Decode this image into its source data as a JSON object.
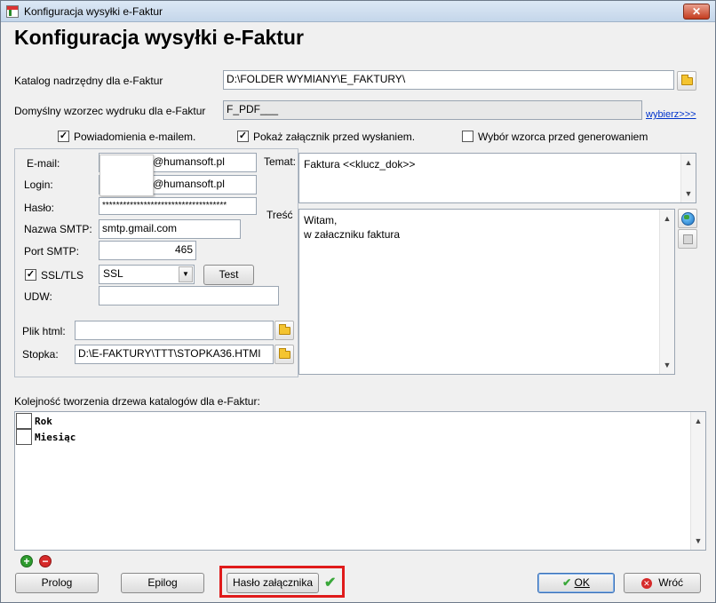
{
  "window": {
    "title": "Konfiguracja wysyłki e-Faktur",
    "close_glyph": "✕"
  },
  "heading": "Konfiguracja wysyłki e-Faktur",
  "catalog": {
    "label": "Katalog nadrzędny dla e-Faktur",
    "value": "D:\\FOLDER WYMIANY\\E_FAKTURY\\"
  },
  "template": {
    "label": "Domyślny wzorzec wydruku dla e-Faktur",
    "value": "F_PDF___",
    "link": "wybierz>>>"
  },
  "options": [
    {
      "label": "Powiadomienia e-mailem.",
      "checked": true
    },
    {
      "label": "Pokaż załącznik przed wysłaniem.",
      "checked": true
    },
    {
      "label": "Wybór wzorca przed generowaniem",
      "checked": false
    }
  ],
  "mail": {
    "email_label": "E-mail:",
    "email_value": "@humansoft.pl",
    "login_label": "Login:",
    "login_value": "@humansoft.pl",
    "password_label": "Hasło:",
    "password_value": "************************************",
    "smtp_label": "Nazwa SMTP:",
    "smtp_value": "smtp.gmail.com",
    "port_label": "Port SMTP:",
    "port_value": "465",
    "ssl_label": "SSL/TLS",
    "ssl_checked": true,
    "ssl_select": "SSL",
    "test_button": "Test",
    "udw_label": "UDW:",
    "udw_value": "",
    "html_label": "Plik html:",
    "html_value": "",
    "footer_label": "Stopka:",
    "footer_value": "D:\\E-FAKTURY\\TTT\\STOPKA36.HTMI"
  },
  "subject": {
    "label": "Temat:",
    "value": "Faktura <<klucz_dok>>"
  },
  "body": {
    "label": "Treść",
    "line1": "Witam,",
    "line2": "w załaczniku faktura"
  },
  "tree": {
    "label": "Kolejność tworzenia drzewa katalogów dla e-Faktur:",
    "items": [
      {
        "label": "Rok"
      },
      {
        "label": "Miesiąc"
      }
    ]
  },
  "buttons": {
    "prolog": "Prolog",
    "epilog": "Epilog",
    "attachment_password": "Hasło załącznika",
    "ok": "OK",
    "back": "Wróć"
  },
  "colors": {
    "highlight_border": "#e01b1b",
    "ok_border": "#3a6fb5"
  }
}
